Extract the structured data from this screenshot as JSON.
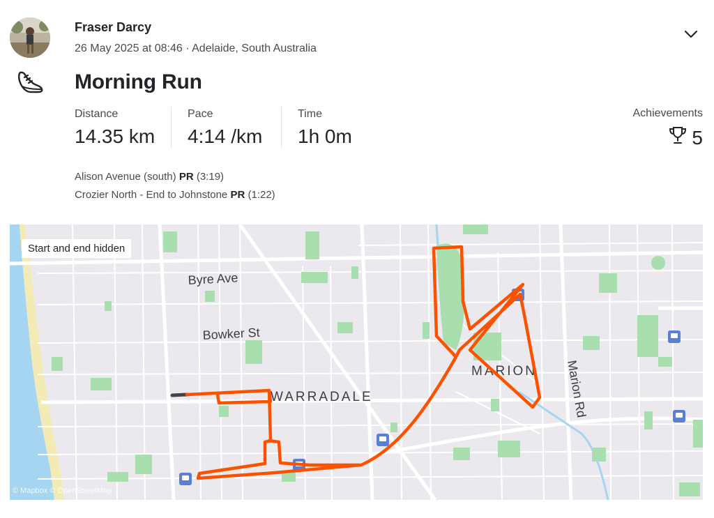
{
  "athlete": {
    "name": "Fraser Darcy"
  },
  "activity": {
    "meta": "26 May 2025 at 08:46 · Adelaide, South Australia",
    "title": "Morning Run"
  },
  "stats": [
    {
      "label": "Distance",
      "value": "14.35 km"
    },
    {
      "label": "Pace",
      "value": "4:14 /km"
    },
    {
      "label": "Time",
      "value": "1h 0m"
    }
  ],
  "achievements": {
    "label": "Achievements",
    "count": "5"
  },
  "segments": [
    {
      "name": "Alison Avenue (south)",
      "badge": "PR",
      "time": "(3:19)"
    },
    {
      "name": "Crozier North - End to Johnstone",
      "badge": "PR",
      "time": "(1:22)"
    }
  ],
  "map": {
    "privacy_label": "Start and end hidden",
    "labels": {
      "byre_ave": "Byre Ave",
      "bowker_st": "Bowker St",
      "warradale": "WARRADALE",
      "marion": "MARION",
      "marion_rd": "Marion Rd"
    },
    "attribution": "© Mapbox © OpenStreetMap",
    "route_color": "#fc5200",
    "water_color": "#a6d5f2",
    "beach_color": "#f3eab5",
    "park_color": "#a9deae"
  },
  "icons": {
    "sport": "running-shoe-icon",
    "expand": "chevron-down-icon",
    "achievements": "trophy-icon",
    "transit": "train-station-icon"
  }
}
